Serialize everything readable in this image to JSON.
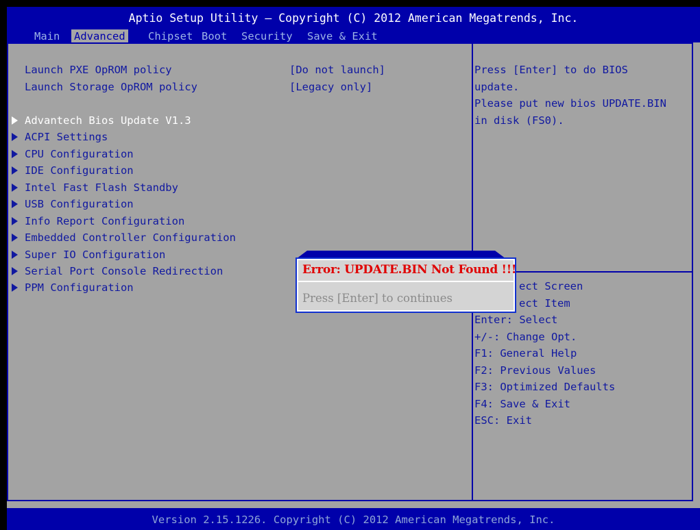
{
  "header": {
    "title": "Aptio Setup Utility – Copyright (C) 2012 American Megatrends, Inc.",
    "tabs": [
      "Main",
      "Advanced",
      "Chipset",
      "Boot",
      "Security",
      "Save & Exit"
    ],
    "active_tab": "Advanced"
  },
  "settings": [
    {
      "label": "Launch PXE OpROM policy",
      "value": "[Do not launch]"
    },
    {
      "label": "Launch Storage OpROM policy",
      "value": "[Legacy only]"
    }
  ],
  "submenus": [
    "Advantech Bios Update V1.3",
    "ACPI Settings",
    "CPU Configuration",
    "IDE Configuration",
    "Intel Fast Flash Standby",
    "USB Configuration",
    "Info Report Configuration",
    "Embedded Controller Configuration",
    "Super IO Configuration",
    "Serial Port Console Redirection",
    "PPM Configuration"
  ],
  "selected_submenu": "Advantech Bios Update V1.3",
  "help": {
    "description": [
      "Press [Enter] to do BIOS",
      "update.",
      "Please put new bios UPDATE.BIN",
      "in disk (FS0)."
    ],
    "keys": [
      "ect Screen",
      "ect Item",
      "Enter: Select",
      "+/-: Change Opt.",
      "F1: General Help",
      "F2: Previous Values",
      "F3: Optimized Defaults",
      "F4: Save & Exit",
      "ESC: Exit"
    ]
  },
  "dialog": {
    "error": "Error: UPDATE.BIN Not Found !!!",
    "message": "Press [Enter] to continues"
  },
  "footer": {
    "text": "Version 2.15.1226. Copyright (C) 2012 American Megatrends, Inc."
  },
  "colors": {
    "header_bg": "#0000AA",
    "panel_bg": "#A3A3A3",
    "text": "#1018A0",
    "selected_text": "#FFFFFF",
    "error_text": "#E00000"
  }
}
